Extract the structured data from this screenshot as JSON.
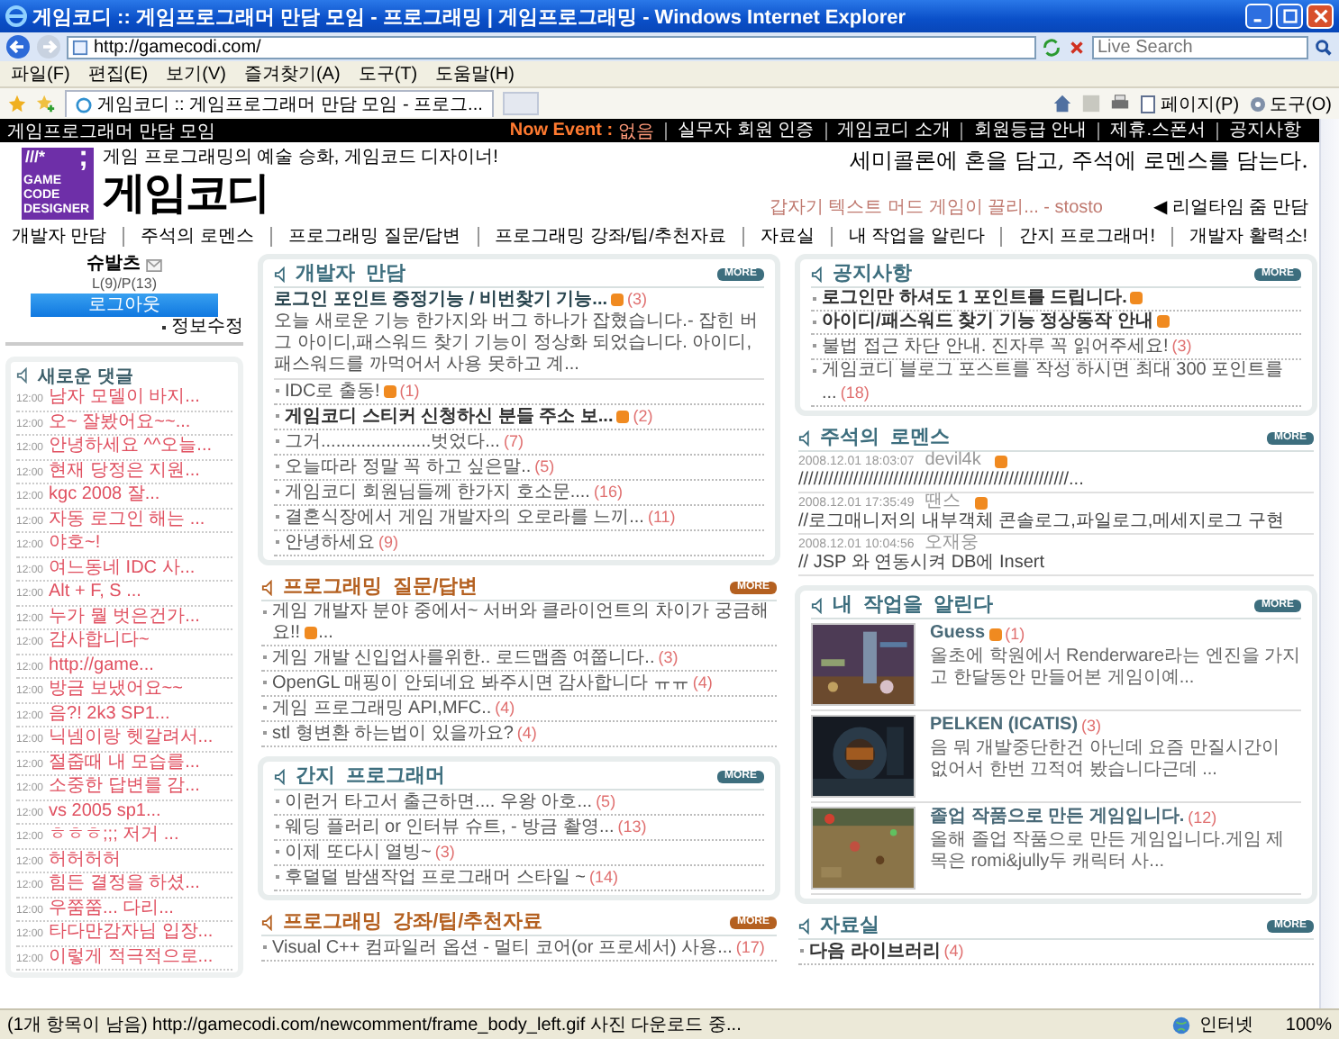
{
  "window": {
    "title": "게임코디 :: 게임프로그래머 만담 모임 - 프로그래밍 | 게임프로그래밍 - Windows Internet Explorer"
  },
  "address_bar": {
    "url": "http://gamecodi.com/",
    "search_placeholder": "Live Search"
  },
  "menu": [
    "파일(F)",
    "편집(E)",
    "보기(V)",
    "즐겨찾기(A)",
    "도구(T)",
    "도움말(H)"
  ],
  "tabs": [
    {
      "label": "게임코디 :: 게임프로그래머 만담 모임 - 프로그...",
      "selected": true
    }
  ],
  "command_bar": [
    "페이지(P)",
    "도구(O)"
  ],
  "site": {
    "top_title": "게임프로그래머 만담 모임",
    "event_label": "Now Event :",
    "event_value": "없음",
    "top_links": [
      "실무자 회원 인증",
      "게임코디 소개",
      "회원등급 안내",
      "제휴.스폰서",
      "공지사항"
    ],
    "logo": {
      "mark": "///*",
      "punct": ";",
      "lines": [
        "GAME",
        "CODE",
        "DESIGNER"
      ]
    },
    "tagline": "게임 프로그래밍의 예술 승화, 게임코드 디자이너!",
    "brand": "게임코디",
    "slogan": "세미콜론에 혼을 담고, 주석에 로멘스를 담는다.",
    "ticker": "갑자기 텍스트 머드 게임이 끌리... - stosto",
    "realtime": "◀ 리얼타임 줌 만담",
    "nav": [
      "개발자 만담",
      "주석의 로멘스",
      "프로그래밍 질문/답변",
      "프로그래밍 강좌/팁/추천자료",
      "자료실",
      "내 작업을 알린다",
      "간지 프로그래머!",
      "개발자 활력소!"
    ]
  },
  "user": {
    "name": "슈발츠",
    "level": "L(9)/P(13)",
    "logout": "로그아웃",
    "edit": "정보수정"
  },
  "new_comments": {
    "title": "새로운 댓글",
    "items": [
      {
        "time": "12:00",
        "text": "남자 모델이 바지..."
      },
      {
        "time": "12:00",
        "text": "오~ 잘봤어요~~..."
      },
      {
        "time": "12:00",
        "text": "안녕하세요 ^^오늘..."
      },
      {
        "time": "12:00",
        "text": "현재 당정은 지원..."
      },
      {
        "time": "12:00",
        "text": "kgc 2008 잘..."
      },
      {
        "time": "12:00",
        "text": "자동 로그인 해는 ..."
      },
      {
        "time": "12:00",
        "text": "야호~!"
      },
      {
        "time": "12:00",
        "text": "여느동네 IDC 사..."
      },
      {
        "time": "12:00",
        "text": "Alt + F, S ..."
      },
      {
        "time": "12:00",
        "text": "누가 뭘 벗은건가..."
      },
      {
        "time": "12:00",
        "text": "감사합니다~"
      },
      {
        "time": "12:00",
        "text": "http://game..."
      },
      {
        "time": "12:00",
        "text": "방금 보냈어요~~"
      },
      {
        "time": "12:00",
        "text": "음?! 2k3 SP1..."
      },
      {
        "time": "12:00",
        "text": "닉넴이랑 헷갈려서..."
      },
      {
        "time": "12:00",
        "text": "절줍때 내 모습를..."
      },
      {
        "time": "12:00",
        "text": "소중한 답변를 감..."
      },
      {
        "time": "12:00",
        "text": "vs 2005 sp1..."
      },
      {
        "time": "12:00",
        "text": "ㅎㅎㅎ;;; 저거 ..."
      },
      {
        "time": "12:00",
        "text": "허허허허"
      },
      {
        "time": "12:00",
        "text": "힘든 결정을 하셨..."
      },
      {
        "time": "12:00",
        "text": "우쭘쭘... 다리..."
      },
      {
        "time": "12:00",
        "text": "타다만감자님 입장..."
      },
      {
        "time": "12:00",
        "text": "이렇게 적극적으로..."
      }
    ]
  },
  "center_sections": [
    {
      "title": "개발자  만담",
      "boxed": true,
      "color": "#3d6e7e",
      "more": "MORE",
      "headline": {
        "text": "로그인 포인트 증정기능 / 비번찾기 기능...",
        "new": true,
        "count": "(3)"
      },
      "summary": "오늘 새로운 기능 한가지와 버그 하나가 잡혔습니다.- 잡힌 버그 아이디,패스워드 찾기 기능이 정상화 되었습니다. 아이디,패스워드를 까먹어서 사용 못하고 계...",
      "items": [
        {
          "text": "IDC로 출동!",
          "bold": false,
          "new": true,
          "count": "(1)"
        },
        {
          "text": "게임코디 스티커 신청하신 분들 주소 보...",
          "bold": true,
          "new": true,
          "count": "(2)"
        },
        {
          "text": "그거......................벗었다...",
          "bold": false,
          "new": false,
          "count": "(7)"
        },
        {
          "text": "오늘따라 정말 꼭 하고 싶은말..",
          "bold": false,
          "new": false,
          "count": "(5)"
        },
        {
          "text": "게임코디 회원님들께 한가지 호소문....",
          "bold": false,
          "new": false,
          "count": "(16)"
        },
        {
          "text": "결혼식장에서 게임 개발자의 오로라를 느끼...",
          "bold": false,
          "new": false,
          "count": "(11)"
        },
        {
          "text": "안녕하세요",
          "bold": false,
          "new": false,
          "count": "(9)"
        }
      ]
    },
    {
      "title": "프로그래밍  질문/답변",
      "boxed": false,
      "color": "#b46020",
      "more": "MORE",
      "items": [
        {
          "text": "게임 개발자 분야 중에서~ 서버와 클라이언트의 차이가 궁금해요!!",
          "new": true,
          "after": "..."
        },
        {
          "text": "게임 개발 신입업사를위한.. 로드맵좀 여쭙니다..",
          "new": false,
          "count": "(3)"
        },
        {
          "text": "OpenGL 매핑이 안되네요 봐주시면 감사합니다 ㅠㅠ",
          "new": false,
          "count": "(4)"
        },
        {
          "text": "게임 프로그래밍 API,MFC..",
          "new": false,
          "count": "(4)"
        },
        {
          "text": "stl 형변환 하는법이 있을까요?",
          "new": false,
          "count": "(4)"
        }
      ]
    },
    {
      "title": "간지  프로그래머",
      "boxed": true,
      "color": "#3d6e7e",
      "more": "MORE",
      "items": [
        {
          "text": "이런거 타고서 출근하면.... 우왕 아호...",
          "new": false,
          "count": "(5)"
        },
        {
          "text": "웨딩 플러리 or 인터뷰 슈트, - 방금 촬영...",
          "new": false,
          "count": "(13)"
        },
        {
          "text": "이제 또다시 열빙~",
          "new": false,
          "count": "(3)"
        },
        {
          "text": "후덜덜 밤샘작업 프로그래머 스타일 ~",
          "new": false,
          "count": "(14)"
        }
      ]
    },
    {
      "title": "프로그래밍  강좌/팁/추천자료",
      "boxed": false,
      "color": "#b46020",
      "more": "MORE",
      "items": [
        {
          "text": "Visual C++ 컴파일러 옵션 - 멀티 코어(or 프로세서) 사용...",
          "new": false,
          "count": "(17)"
        }
      ]
    }
  ],
  "right_sections": [
    {
      "kind": "topics",
      "title": "공지사항",
      "boxed": true,
      "color": "#3d6e7e",
      "more": "MORE",
      "items": [
        {
          "text": "로그인만 하셔도 1 포인트를 드립니다.",
          "bold": true,
          "new": true
        },
        {
          "text": "아이디/패스워드 찾기 기능 정상동작 안내",
          "bold": true,
          "new": true
        },
        {
          "text": "불법 접근 차단 안내. 진자루 꼭 읽어주세요!",
          "bold": false,
          "new": false,
          "count": "(3)"
        },
        {
          "text": "게임코디 블로그 포스트를 작성 하시면 최대 300 포인트를 ...",
          "bold": false,
          "new": false,
          "count": "(18)"
        }
      ]
    },
    {
      "kind": "notes",
      "title": "주석의  로멘스",
      "boxed": false,
      "color": "#3d6e7e",
      "more": "MORE",
      "items": [
        {
          "date": "2008.12.01 18:03:07",
          "author": "devil4k",
          "badge": true,
          "body": "//////////////////////////////////////////////////////..."
        },
        {
          "date": "2008.12.01 17:35:49",
          "author": "땐스",
          "badge": true,
          "body": "//로그매니저의 내부객체 콘솔로그,파일로그,메세지로그 구현"
        },
        {
          "date": "2008.12.01 10:04:56",
          "author": "오재웅",
          "badge": false,
          "body": "// JSP 와 연동시켜 DB에 Insert"
        }
      ]
    },
    {
      "kind": "works",
      "title": "내  작업을  알린다",
      "boxed": true,
      "color": "#3d6e7e",
      "more": "MORE",
      "items": [
        {
          "title": "Guess",
          "new": true,
          "count": "(1)",
          "desc": "올초에 학원에서 Renderware라는 엔진을 가지고 한달동안 만들어본 게임이예..."
        },
        {
          "title": "PELKEN (ICATIS)",
          "new": false,
          "count": "(3)",
          "desc": "음 뭐 개발중단한건 아닌데 요즘 만질시간이 없어서 한번 끄적여 봤습니다근데 ..."
        },
        {
          "title": "졸업 작품으로 만든 게임입니다.",
          "new": false,
          "count": "(12)",
          "desc": "올해 졸업 작품으로 만든 게임입니다.게임 제목은 romi&jully두 캐릭터 사..."
        }
      ]
    },
    {
      "kind": "topics",
      "title": "자료실",
      "boxed": false,
      "color": "#3d6e7e",
      "more": "MORE",
      "items": [
        {
          "text": "다음 라이브러리",
          "bold": true,
          "new": false,
          "count": "(4)"
        }
      ]
    }
  ],
  "status_bar": {
    "text": "(1개 항목이 남음) http://gamecodi.com/newcomment/frame_body_left.gif 사진 다운로드 중...",
    "zone": "인터넷",
    "zoom": "100%"
  }
}
